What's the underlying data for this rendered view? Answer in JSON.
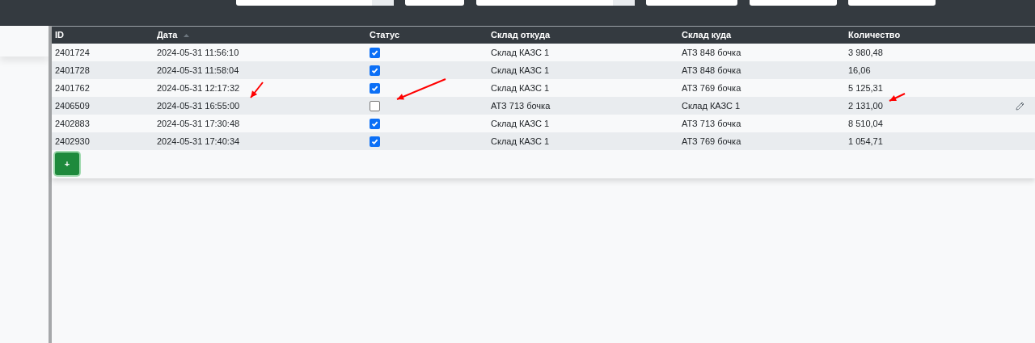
{
  "table": {
    "columns": [
      {
        "label": "ID",
        "sorted": false
      },
      {
        "label": "Дата",
        "sorted": true
      },
      {
        "label": "Статус",
        "sorted": false
      },
      {
        "label": "Склад откуда",
        "sorted": false
      },
      {
        "label": "Склад куда",
        "sorted": false
      },
      {
        "label": "Количество",
        "sorted": false
      }
    ],
    "rows": [
      {
        "id": "2401724",
        "date": "2024-05-31 11:56:10",
        "checked": true,
        "from": "Склад КАЗС 1",
        "to": "АТЗ 848 бочка",
        "qty": "3 980,48",
        "hovered": false
      },
      {
        "id": "2401728",
        "date": "2024-05-31 11:58:04",
        "checked": true,
        "from": "Склад КАЗС 1",
        "to": "АТЗ 848 бочка",
        "qty": "16,06",
        "hovered": false
      },
      {
        "id": "2401762",
        "date": "2024-05-31 12:17:32",
        "checked": true,
        "from": "Склад КАЗС 1",
        "to": "АТЗ 769 бочка",
        "qty": "5 125,31",
        "hovered": false
      },
      {
        "id": "2406509",
        "date": "2024-05-31 16:55:00",
        "checked": false,
        "from": "АТЗ 713 бочка",
        "to": "Склад КАЗС 1",
        "qty": "2 131,00",
        "hovered": true
      },
      {
        "id": "2402883",
        "date": "2024-05-31 17:30:48",
        "checked": true,
        "from": "Склад КАЗС 1",
        "to": "АТЗ 713 бочка",
        "qty": "8 510,04",
        "hovered": false
      },
      {
        "id": "2402930",
        "date": "2024-05-31 17:40:34",
        "checked": true,
        "from": "Склад КАЗС 1",
        "to": "АТЗ 769 бочка",
        "qty": "1 054,71",
        "hovered": false
      }
    ],
    "add_button": "+"
  }
}
